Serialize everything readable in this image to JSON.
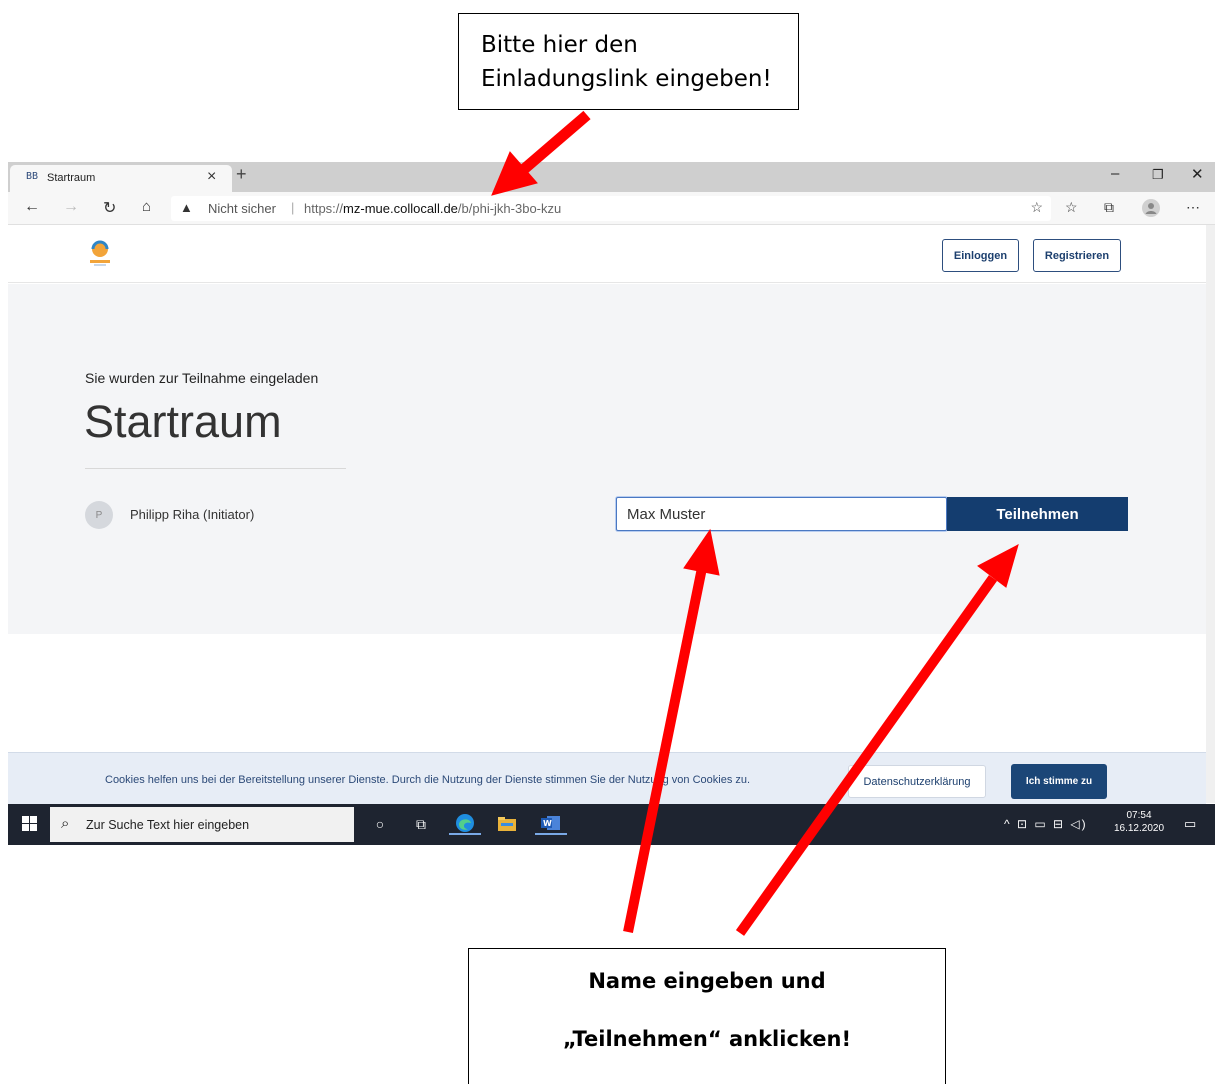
{
  "callouts": {
    "top_line1": "Bitte hier den",
    "top_line2": "Einladungslink eingeben!",
    "bottom_line1": "Name eingeben und",
    "bottom_line2": "„Teilnehmen“ anklicken!"
  },
  "browser": {
    "tab_title": "Startraum",
    "address_warning": "Nicht sicher",
    "url_prefix": "https://",
    "url_host": "mz-mue.collocall.de",
    "url_path": "/b/phi-jkh-3bo-kzu"
  },
  "header": {
    "login_label": "Einloggen",
    "register_label": "Registrieren"
  },
  "room": {
    "invite_text": "Sie wurden zur Teilnahme eingeladen",
    "title": "Startraum",
    "owner_initial": "P",
    "owner_name": "Philipp Riha (Initiator)",
    "name_value": "Max Muster",
    "join_label": "Teilnehmen"
  },
  "cookie": {
    "text": "Cookies helfen uns bei der Bereitstellung unserer Dienste. Durch die Nutzung der Dienste stimmen Sie der Nutzung von Cookies zu.",
    "privacy_label": "Datenschutzerklärung",
    "accept_label": "Ich stimme zu"
  },
  "taskbar": {
    "search_placeholder": "Zur Suche Text hier eingeben",
    "time": "07:54",
    "date": "16.12.2020"
  },
  "colors": {
    "primary": "#143d6f",
    "arrow": "#ff0000",
    "taskbar": "#1e2430"
  }
}
